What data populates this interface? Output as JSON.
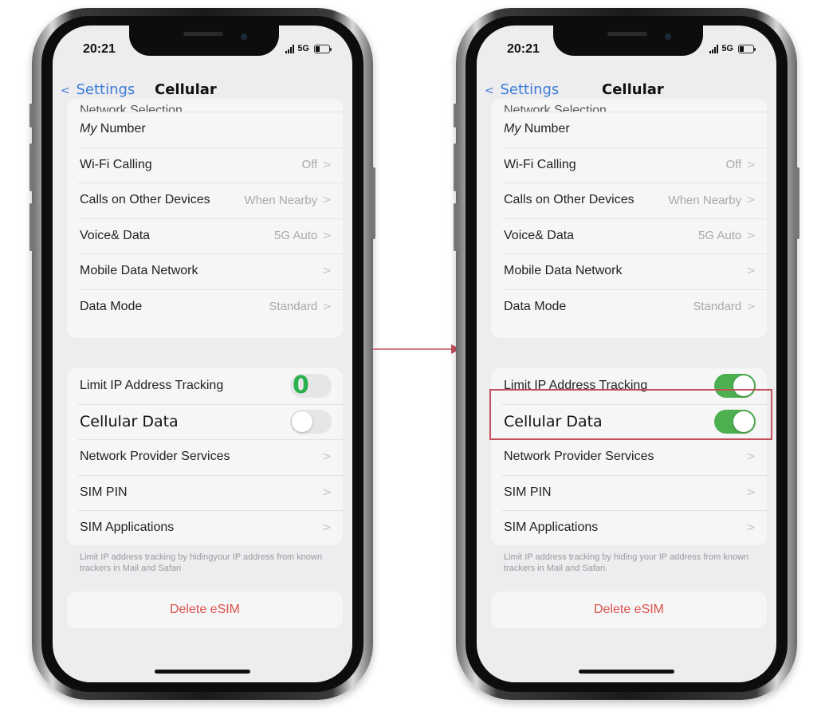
{
  "phones": [
    {
      "status_time": "20:21",
      "network": "5G",
      "back_label": "Settings",
      "title": "Cellular",
      "cut_row": "Network Selection",
      "group1": [
        {
          "label": "My Number",
          "value": ""
        },
        {
          "label": "Wi-Fi Calling",
          "value": "Off"
        },
        {
          "label": "Calls on Other Devices",
          "value": "When Nearby"
        },
        {
          "label": "Voice& Data",
          "value": "5G Auto"
        },
        {
          "label": "Mobile Data Network",
          "value": ""
        },
        {
          "label": "Data Mode",
          "value": "Standard"
        }
      ],
      "limit_ip_label": "Limit IP Address Tracking",
      "limit_ip_on": false,
      "limit_ip_overlay": "0",
      "cellular_data_label": "Cellular Data",
      "cellular_data_on": false,
      "group2_nav": [
        {
          "label": "Network Provider Services"
        },
        {
          "label": "SIM PIN"
        },
        {
          "label": "SIM Applications"
        }
      ],
      "footnote": "Limit IP address tracking by hidingyour IP address from known trackers in Mail and Safari",
      "delete_label": "Delete eSIM"
    },
    {
      "status_time": "20:21",
      "network": "5G",
      "back_label": "Settings",
      "title": "Cellular",
      "cut_row": "Network Selection",
      "group1": [
        {
          "label": "My Number",
          "value": ""
        },
        {
          "label": "Wi-Fi Calling",
          "value": "Off"
        },
        {
          "label": "Calls on Other Devices",
          "value": "When Nearby"
        },
        {
          "label": "Voice& Data",
          "value": "5G Auto"
        },
        {
          "label": "Mobile Data Network",
          "value": ""
        },
        {
          "label": "Data Mode",
          "value": "Standard"
        }
      ],
      "limit_ip_label": "Limit IP Address Tracking",
      "limit_ip_on": true,
      "cellular_data_label": "Cellular Data",
      "cellular_data_on": true,
      "group2_nav": [
        {
          "label": "Network Provider Services"
        },
        {
          "label": "SIM PIN"
        },
        {
          "label": "SIM Applications"
        }
      ],
      "footnote": "Limit IP address tracking by hiding your IP address from known trackers in Mail and Safari.",
      "delete_label": "Delete eSIM"
    }
  ],
  "colors": {
    "toggle_on": "#4caf50",
    "accent_blue": "#3d7cd9",
    "delete_red": "#d9534f",
    "highlight_box": "#c4505c",
    "arrow": "#c4505c"
  }
}
